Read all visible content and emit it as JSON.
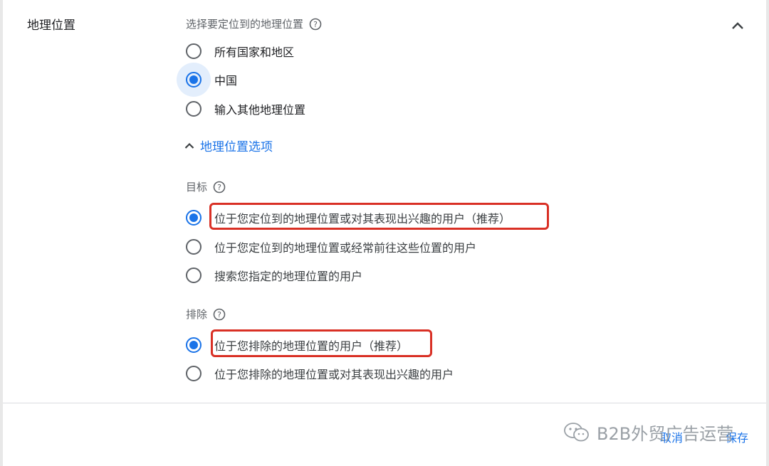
{
  "section": {
    "title": "地理位置"
  },
  "locations": {
    "subtitle": "选择要定位到的地理位置",
    "options": [
      {
        "label": "所有国家和地区",
        "checked": false
      },
      {
        "label": "中国",
        "checked": true
      },
      {
        "label": "输入其他地理位置",
        "checked": false
      }
    ]
  },
  "location_options": {
    "toggle_label": "地理位置选项"
  },
  "target": {
    "subtitle": "目标",
    "options": [
      {
        "label": "位于您定位到的地理位置或对其表现出兴趣的用户（推荐）",
        "checked": true
      },
      {
        "label": "位于您定位到的地理位置或经常前往这些位置的用户",
        "checked": false
      },
      {
        "label": "搜索您指定的地理位置的用户",
        "checked": false
      }
    ]
  },
  "exclude": {
    "subtitle": "排除",
    "options": [
      {
        "label": "位于您排除的地理位置的用户（推荐）",
        "checked": true
      },
      {
        "label": "位于您排除的地理位置或对其表现出兴趣的用户",
        "checked": false
      }
    ]
  },
  "footer": {
    "cancel_label": "取消",
    "save_label": "保存"
  },
  "watermark": {
    "text": "B2B外贸广告运营"
  },
  "colors": {
    "accent": "#1a73e8",
    "highlight": "#d93025",
    "muted": "#5f6368"
  }
}
